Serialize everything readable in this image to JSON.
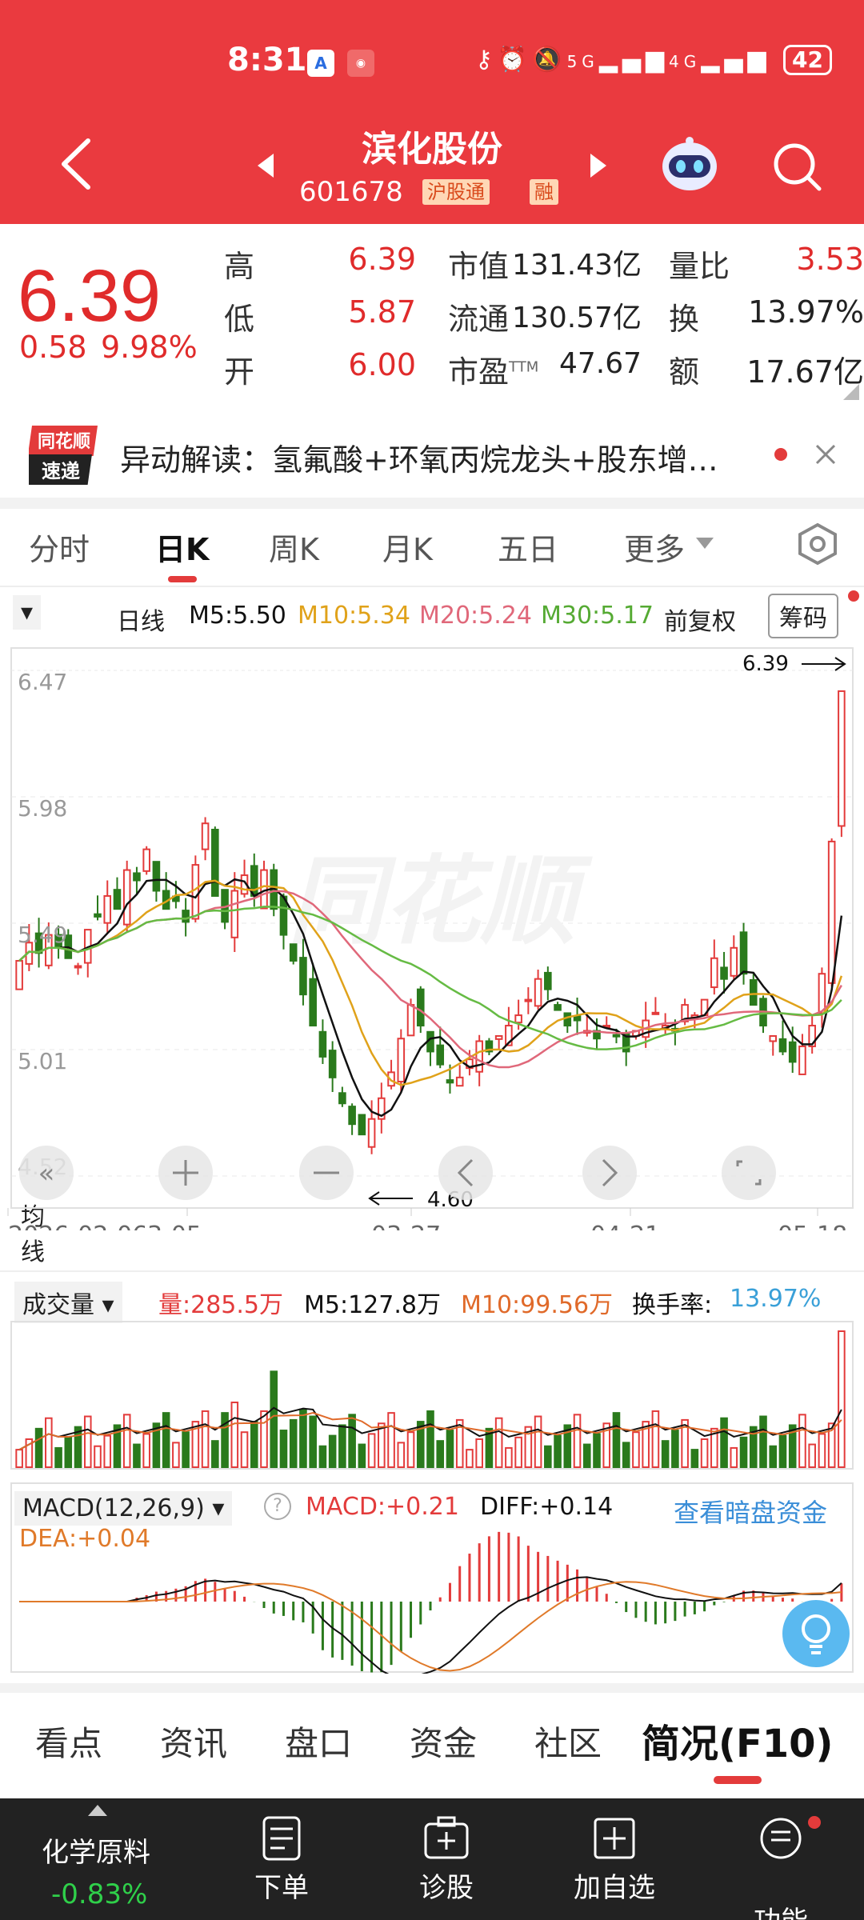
{
  "status_bar": {
    "time": "8:31",
    "network_5g": "5G",
    "network_4g": "4G",
    "battery": "42"
  },
  "header": {
    "title": "滨化股份",
    "code": "601678",
    "tag_hgt": "沪股通",
    "tag_rong": "融"
  },
  "quote": {
    "price": "6.39",
    "change": "0.58",
    "change_pct": "9.98%",
    "high_label": "高",
    "high": "6.39",
    "low_label": "低",
    "low": "5.87",
    "open_label": "开",
    "open": "6.00",
    "mcap_label": "市值",
    "mcap": "131.43亿",
    "float_label": "流通",
    "float": "130.57亿",
    "pe_label": "市盈",
    "pe_sup": "TTM",
    "pe": "47.67",
    "vr_label": "量比",
    "vr": "3.53",
    "turnover_label": "换",
    "turnover": "13.97%",
    "amount_label": "额",
    "amount": "17.67亿"
  },
  "news": {
    "logo_top": "同花顺",
    "logo_bottom": "速递",
    "text": "异动解读：氢氟酸+环氧丙烷龙头+股东增…"
  },
  "period_tabs": [
    "分时",
    "日K",
    "周K",
    "月K",
    "五日",
    "更多"
  ],
  "ma_bar": {
    "dropdown": "均线",
    "period": "日线",
    "m5": "M5:5.50",
    "m10": "M10:5.34",
    "m20": "M20:5.24",
    "m30": "M30:5.17",
    "adjust": "前复权",
    "chips": "筹码"
  },
  "kline": {
    "y_ticks": [
      "6.47",
      "5.98",
      "5.49",
      "5.01",
      "4.52"
    ],
    "x_ticks": [
      "2026-02-06",
      "3-05",
      "03-27",
      "04-21",
      "05-18"
    ],
    "high_marker": "6.39",
    "low_marker": "4.60",
    "watermark": "同花顺",
    "colors": {
      "up": "#e33b3b",
      "down": "#2a7a1c",
      "m5": "#111111",
      "m10": "#e0a21a",
      "m20": "#e0687a",
      "m30": "#66bb44"
    }
  },
  "volume": {
    "dropdown": "成交量",
    "vol": "量:285.5万",
    "m5": "M5:127.8万",
    "m10": "M10:99.56万",
    "turnover_label": "换手率:",
    "turnover": "13.97%"
  },
  "macd": {
    "dropdown": "MACD(12,26,9)",
    "macd": "MACD:+0.21",
    "diff": "DIFF:+0.14",
    "dea": "DEA:+0.04",
    "link": "查看暗盘资金"
  },
  "bottom_tabs": [
    "看点",
    "资讯",
    "盘口",
    "资金",
    "社区",
    "简况(F10)"
  ],
  "navbar": {
    "sector": "化学原料",
    "sector_chg": "-0.83%",
    "items": [
      "下单",
      "诊股",
      "加自选",
      "功能"
    ]
  }
}
